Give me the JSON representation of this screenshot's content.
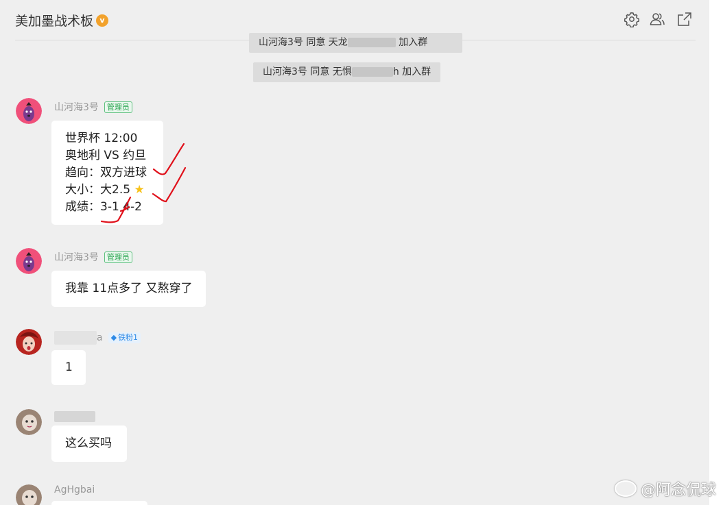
{
  "header": {
    "title": "美加墨战术板",
    "badge_letter": "v",
    "icons": [
      "settings-icon",
      "members-icon",
      "popout-icon"
    ]
  },
  "system_messages": [
    {
      "prefix": "山河海3号 同意 天龙",
      "suffix": "加入群"
    },
    {
      "prefix": "山河海3号 同意 无惧",
      "suffix": "h 加入群"
    }
  ],
  "messages": [
    {
      "sender": "山河海3号",
      "badge": "管理员",
      "lines": [
        "世界杯 12:00",
        "奥地利 VS 约旦",
        "趋向：双方进球",
        "大小：大2.5",
        "成绩：3-1 4-2"
      ],
      "star": "★"
    },
    {
      "sender": "山河海3号",
      "badge": "管理员",
      "lines": [
        "我靠 11点多了 又熬穿了"
      ]
    },
    {
      "sender_suffix": "a",
      "badge": "铁粉1",
      "lines": [
        "1"
      ]
    },
    {
      "sender": "",
      "lines": [
        "这么买吗"
      ]
    },
    {
      "sender": "AgHgbai"
    }
  ],
  "watermark": "@阿念侃球",
  "colors": {
    "background": "#efefef",
    "bubble": "#ffffff",
    "admin_badge": "#22a34a",
    "fan_badge": "#2e8ae6",
    "annotation_red": "#e0101a"
  }
}
